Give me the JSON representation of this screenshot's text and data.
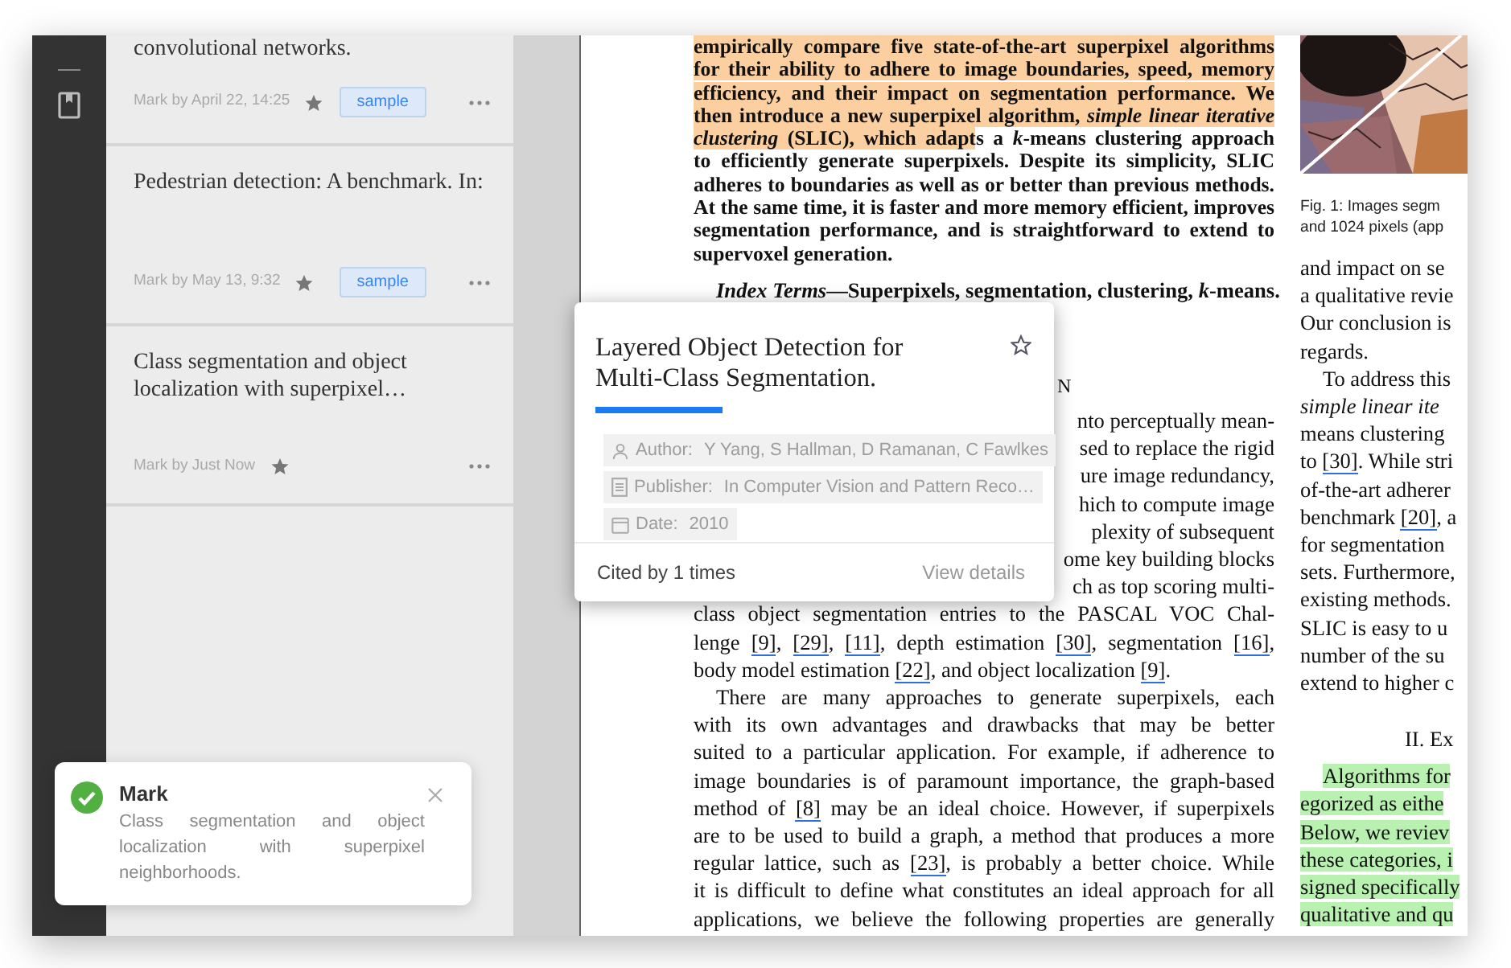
{
  "marks": [
    {
      "title": "convolutional networks.",
      "meta": "Mark by April 22, 14:25",
      "tag": "sample"
    },
    {
      "title": "Pedestrian detection: A benchmark. In:",
      "meta": "Mark by May 13, 9:32",
      "tag": "sample"
    },
    {
      "title": "Class segmentation and object localization with superpixel…",
      "meta": "Mark by Just Now"
    }
  ],
  "paper": {
    "left_column": [
      {
        "kind": "abstract",
        "lines": [
          {
            "text": "empirically compare five state-of-the-art superpixel algorithms",
            "kind": "highlight"
          },
          {
            "text": "for their ability to adhere to image boundaries, speed, memory",
            "kind": "highlight"
          },
          {
            "text": "efficiency, and their impact on segmentation performance. We",
            "kind": "highlight"
          },
          {
            "text": "then introduce a new superpixel algorithm, *simple linear iterative*",
            "kind": "highlight"
          },
          {
            "segments": [
              {
                "text": "*clustering* (SLIC), which adapt",
                "kind": "highlight"
              },
              {
                "text": "s a *k*-means clustering approach"
              }
            ]
          },
          {
            "text": "to efficiently generate superpixels. Despite its simplicity, SLIC"
          },
          {
            "text": "adheres to boundaries as well as or better than previous methods."
          },
          {
            "text": "At the same time, it is faster and more memory efficient, improves"
          },
          {
            "text": "segmentation performance, and is straightforward to extend to"
          },
          {
            "text": "supervoxel generation."
          }
        ]
      },
      {
        "kind": "index_terms",
        "lines": [
          {
            "text": "*Index Terms*—Superpixels, segmentation, clustering, *k*-means."
          }
        ]
      },
      {
        "kind": "heading",
        "lines": [
          {
            "text": "N"
          }
        ]
      },
      {
        "kind": "covered",
        "lines": [
          {
            "text": "nto perceptually mean-"
          },
          {
            "text": "sed to replace the rigid"
          },
          {
            "text": "ure image redundancy,"
          },
          {
            "text": "hich to compute image"
          },
          {
            "text": "plexity of subsequent"
          },
          {
            "text": "ome key building blocks"
          },
          {
            "text": "ch as top scoring multi-"
          }
        ]
      },
      {
        "kind": "body",
        "lines": [
          {
            "text": "class object segmentation entries to the PASCAL VOC Chal-"
          },
          {
            "segments": [
              {
                "text": "lenge "
              },
              {
                "text": "[9]",
                "kind": "citation"
              },
              {
                "text": ", "
              },
              {
                "text": "[29]",
                "kind": "citation"
              },
              {
                "text": ", "
              },
              {
                "text": "[11]",
                "kind": "citation"
              },
              {
                "text": ", depth estimation "
              },
              {
                "text": "[30]",
                "kind": "citation"
              },
              {
                "text": ", segmentation "
              },
              {
                "text": "[16]",
                "kind": "citation"
              },
              {
                "text": ","
              }
            ]
          },
          {
            "segments": [
              {
                "text": "body model estimation "
              },
              {
                "text": "[22]",
                "kind": "citation"
              },
              {
                "text": ", and object localization "
              },
              {
                "text": "[9]",
                "kind": "citation"
              },
              {
                "text": "."
              }
            ]
          }
        ]
      },
      {
        "kind": "body",
        "indent": true,
        "continued": true,
        "lines": [
          {
            "text": "There are many approaches to generate superpixels, each"
          },
          {
            "text": "with its own advantages and drawbacks that may be better"
          },
          {
            "text": "suited to a particular application. For example, if adherence to"
          },
          {
            "text": "image boundaries is of paramount importance, the graph-based"
          },
          {
            "segments": [
              {
                "text": "method of "
              },
              {
                "text": "[8]",
                "kind": "citation"
              },
              {
                "text": " may be an ideal choice. However, if superpixels"
              }
            ]
          },
          {
            "text": "are to be used to build a graph, a method that produces a more"
          },
          {
            "segments": [
              {
                "text": "regular lattice, such as "
              },
              {
                "text": "[23]",
                "kind": "citation"
              },
              {
                "text": ", is probably a better choice. While"
              }
            ]
          },
          {
            "text": "it is difficult to define what constitutes an ideal approach for all"
          },
          {
            "text": "applications, we believe the following properties are generally"
          }
        ]
      }
    ],
    "right_column": [
      {
        "kind": "figure"
      },
      {
        "kind": "caption",
        "lines": [
          {
            "text": "Fig. 1: Images segm"
          },
          {
            "text": "and 1024 pixels (app"
          }
        ]
      },
      {
        "kind": "body",
        "lines": [
          {
            "text": "and impact on se"
          },
          {
            "text": "a qualitative revie"
          },
          {
            "text": "Our conclusion is"
          },
          {
            "text": "regards."
          }
        ]
      },
      {
        "kind": "body",
        "indent": true,
        "lines": [
          {
            "text": "To address this"
          },
          {
            "text": "*simple linear ite*"
          },
          {
            "text": "means clustering"
          },
          {
            "segments": [
              {
                "text": "to "
              },
              {
                "text": "[30]",
                "kind": "citation"
              },
              {
                "text": ". While stri"
              }
            ]
          },
          {
            "text": "of-the-art adherer"
          },
          {
            "segments": [
              {
                "text": "benchmark "
              },
              {
                "text": "[20]",
                "kind": "citation"
              },
              {
                "text": ", a"
              }
            ]
          },
          {
            "text": "for segmentation"
          },
          {
            "text": "sets. Furthermore,"
          },
          {
            "text": "existing methods."
          },
          {
            "text": "SLIC is easy to u"
          },
          {
            "text": "number of the su"
          },
          {
            "text": "extend to higher c"
          }
        ]
      },
      {
        "kind": "heading",
        "lines": [
          {
            "text": "II. Ex"
          }
        ]
      },
      {
        "kind": "body",
        "indent": true,
        "lines": [
          {
            "text": "Algorithms for",
            "kind": "highlight"
          },
          {
            "text": "egorized as eithe",
            "kind": "highlight"
          },
          {
            "text": "Below, we reviev",
            "kind": "highlight"
          },
          {
            "text": "these categories, i",
            "kind": "highlight"
          },
          {
            "text": "signed specifically",
            "kind": "highlight"
          },
          {
            "text": "qualitative and qu",
            "kind": "highlight"
          }
        ]
      }
    ]
  },
  "popup": {
    "title": "Layered Object Detection for Multi-Class Segmentation.",
    "fields": [
      {
        "kind": "author",
        "label": "Author:",
        "value": "Y Yang, S Hallman, D Ramanan, C Fawlkes"
      },
      {
        "kind": "publisher",
        "label": "Publisher:",
        "value": "In Computer Vision and Pattern Reco…"
      },
      {
        "kind": "date",
        "label": "Date:",
        "value": "2010"
      }
    ],
    "cited": "Cited by 1 times",
    "link": "View details"
  },
  "toast": {
    "title": "Mark",
    "message": "Class segmentation and object localization with superpixel neighborhoods."
  }
}
